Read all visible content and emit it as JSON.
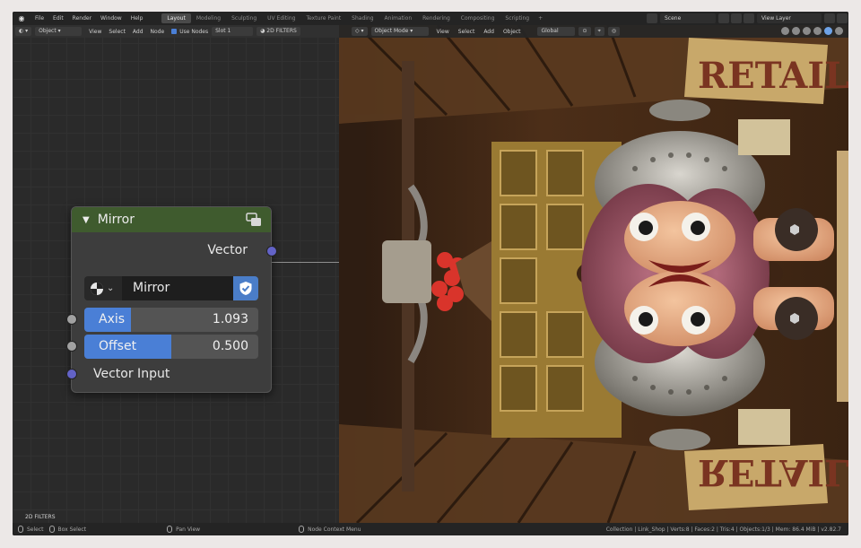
{
  "topbar": {
    "menus": [
      "File",
      "Edit",
      "Render",
      "Window",
      "Help"
    ],
    "workspaces": [
      "Layout",
      "Modeling",
      "Sculpting",
      "UV Editing",
      "Texture Paint",
      "Shading",
      "Animation",
      "Rendering",
      "Compositing",
      "Scripting"
    ],
    "active_workspace": "Layout",
    "scene": "Scene",
    "view_layer": "View Layer"
  },
  "node_editor": {
    "header": {
      "mode": "Object",
      "menus": [
        "View",
        "Select",
        "Add",
        "Node"
      ],
      "use_nodes_label": "Use Nodes",
      "slot": "Slot 1",
      "filter": "2D FILTERS"
    },
    "area_label": "2D FILTERS",
    "node": {
      "title": "Mirror",
      "header_color": "#3f5b2e",
      "output_label": "Vector",
      "datablock_name": "Mirror",
      "axis_label": "Axis",
      "axis_value": "1.093",
      "axis_fill": 0.27,
      "offset_label": "Offset",
      "offset_value": "0.500",
      "offset_fill": 0.5,
      "input_label": "Vector Input"
    }
  },
  "viewport": {
    "header": {
      "mode": "Object Mode",
      "menus": [
        "View",
        "Select",
        "Add",
        "Object"
      ],
      "transform": "Global"
    },
    "sign_text": "RETAIL"
  },
  "statusbar": {
    "items": [
      "Select",
      "Box Select",
      "Pan View",
      "Node Context Menu"
    ],
    "stats": "Collection | Link_Shop | Verts:8 | Faces:2 | Tris:4 | Objects:1/3 | Mem: 86.4 MiB | v2.82.7"
  }
}
